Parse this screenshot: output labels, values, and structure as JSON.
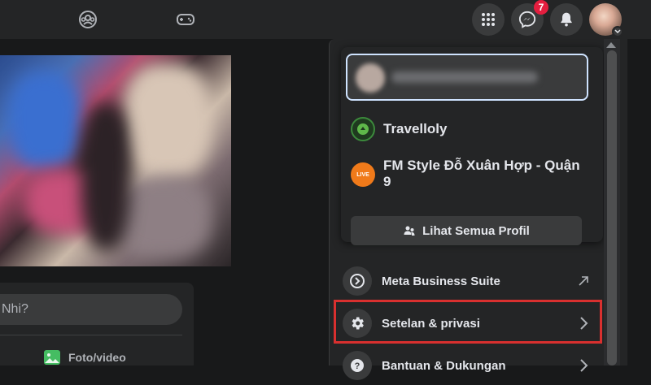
{
  "topbar": {
    "nav_icons": [
      "groups-icon",
      "gaming-icon"
    ],
    "right_icons": [
      "menu-grid-icon",
      "messenger-icon",
      "notifications-icon"
    ],
    "messenger_badge": "7"
  },
  "feed": {
    "composer_placeholder": "Nhi?",
    "photo_video_label": "Foto/video"
  },
  "account_menu": {
    "pages": [
      {
        "name": "Travelloly",
        "icon": "travelloly-page-icon"
      },
      {
        "name": "FM Style Đỗ Xuân Hợp - Quận 9",
        "icon": "fm-style-page-icon",
        "icon_text": "LIVE"
      }
    ],
    "see_all_label": "Lihat Semua Profil",
    "items": [
      {
        "label": "Meta Business Suite",
        "icon": "meta-business-icon",
        "arrow": "external-link-icon"
      },
      {
        "label": "Setelan & privasi",
        "icon": "gear-icon",
        "arrow": "chevron-right-icon"
      },
      {
        "label": "Bantuan & Dukungan",
        "icon": "help-icon",
        "arrow": "chevron-right-icon"
      }
    ]
  },
  "colors": {
    "background": "#18191a",
    "surface": "#242526",
    "highlight": "#d9302f",
    "badge": "#e41e3f"
  }
}
